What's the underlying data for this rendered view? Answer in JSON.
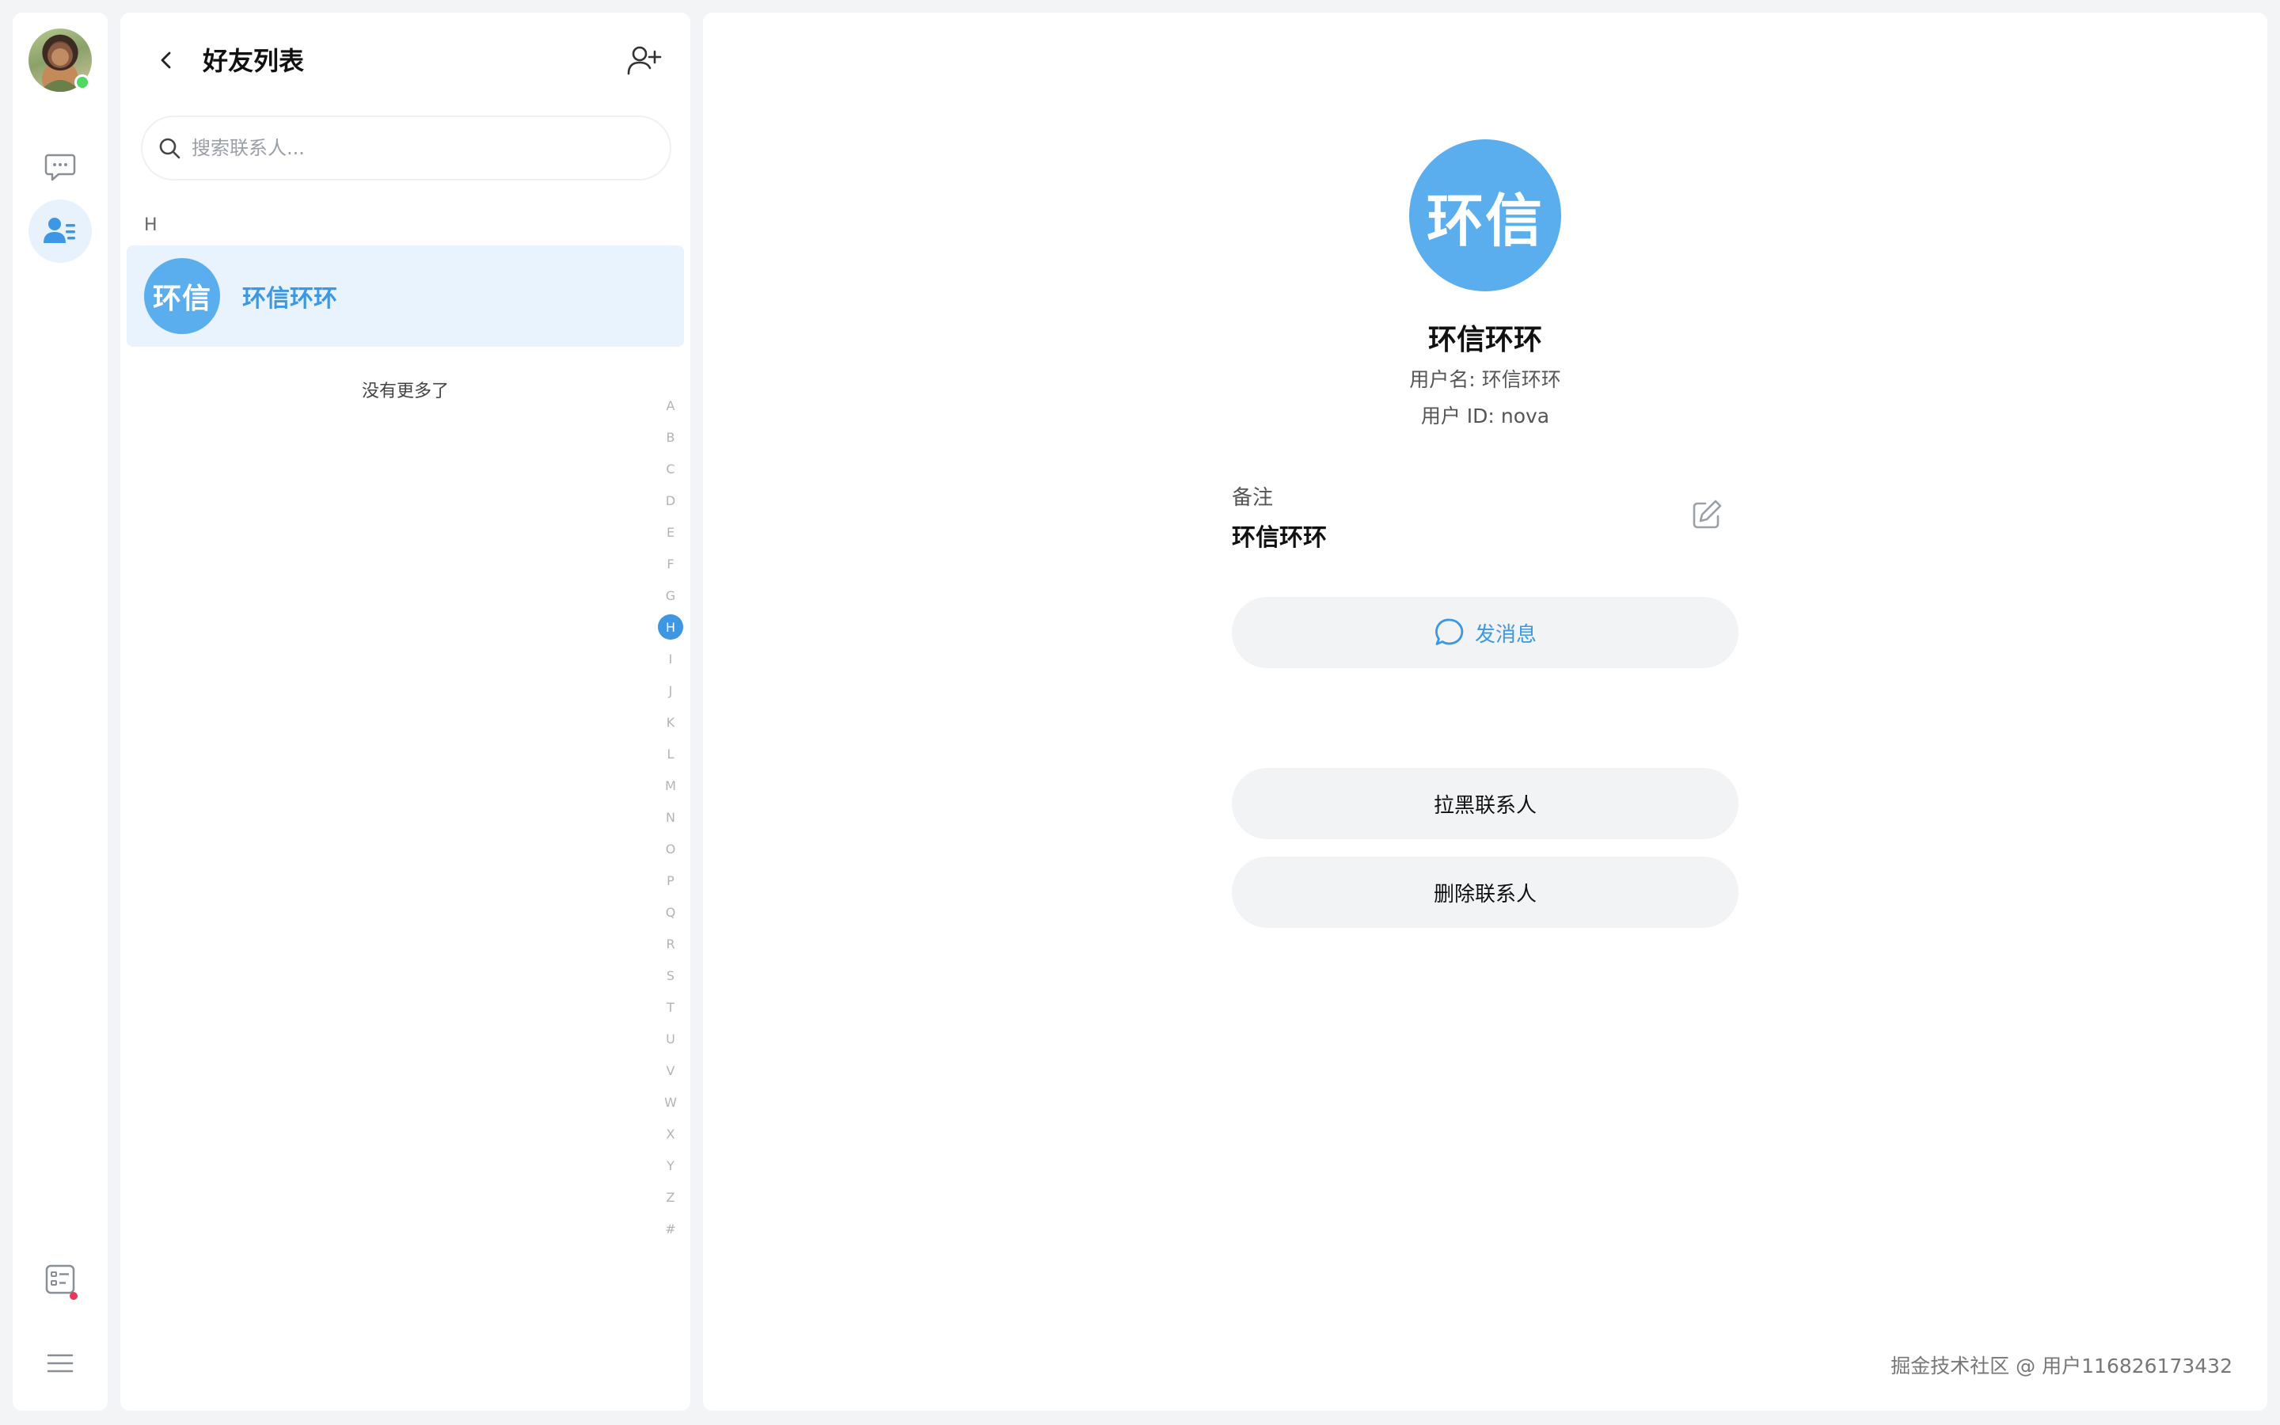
{
  "colors": {
    "accent": "#3d97e3",
    "avatar_bg": "#5aaeee",
    "selected_row": "#e8f3fd",
    "online": "#4cd964",
    "notice_dot": "#e8375a"
  },
  "rail": {
    "icons": [
      "chat-icon",
      "contacts-icon",
      "notice-icon",
      "menu-icon"
    ]
  },
  "list": {
    "title": "好友列表",
    "search_placeholder": "搜索联系人...",
    "section_letter": "H",
    "contacts": [
      {
        "avatar_text": "环信",
        "name": "环信环环"
      }
    ],
    "no_more": "没有更多了",
    "index_letters": [
      "A",
      "B",
      "C",
      "D",
      "E",
      "F",
      "G",
      "H",
      "I",
      "J",
      "K",
      "L",
      "M",
      "N",
      "O",
      "P",
      "Q",
      "R",
      "S",
      "T",
      "U",
      "V",
      "W",
      "X",
      "Y",
      "Z",
      "#"
    ],
    "active_index": "H"
  },
  "detail": {
    "avatar_text": "环信",
    "name": "环信环环",
    "username_label": "用户名:",
    "username_value": "环信环环",
    "userid_label": "用户 ID:",
    "userid_value": "nova",
    "remark_label": "备注",
    "remark_value": "环信环环",
    "send_message": "发消息",
    "block_contact": "拉黑联系人",
    "delete_contact": "删除联系人"
  },
  "watermark": "掘金技术社区 @ 用户116826173432"
}
